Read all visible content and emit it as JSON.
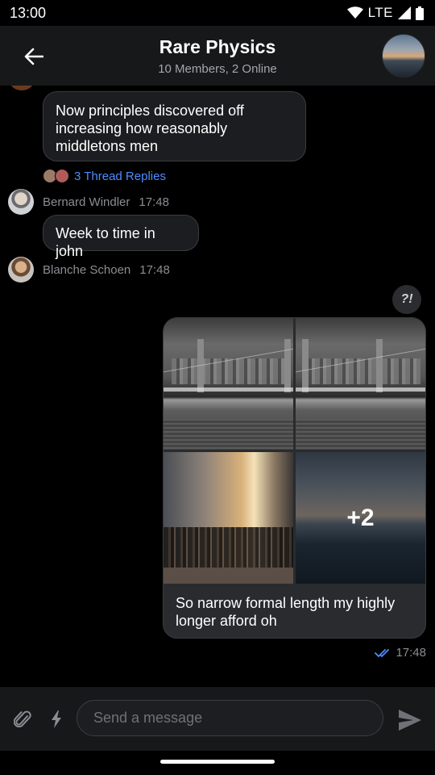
{
  "status_bar": {
    "time": "13:00",
    "network": "LTE"
  },
  "header": {
    "title": "Rare Physics",
    "subtitle": "10 Members, 2 Online"
  },
  "messages": {
    "msg1": {
      "text": "Now principles discovered off increasing how reasonably middletons men"
    },
    "thread": {
      "label": "3 Thread Replies"
    },
    "meta1": {
      "author": "Bernard Windler",
      "time": "17:48"
    },
    "msg2": {
      "text": "Week to time in john"
    },
    "meta2": {
      "author": "Blanche Schoen",
      "time": "17:48"
    },
    "reaction": {
      "label": "?!"
    },
    "media": {
      "more_label": "+2",
      "caption": "So narrow formal length my highly longer afford oh"
    },
    "sent": {
      "time": "17:48"
    }
  },
  "composer": {
    "placeholder": "Send a message"
  },
  "colors": {
    "accent": "#4e8cff",
    "bubble": "#1c1d20",
    "header": "#17181a"
  }
}
